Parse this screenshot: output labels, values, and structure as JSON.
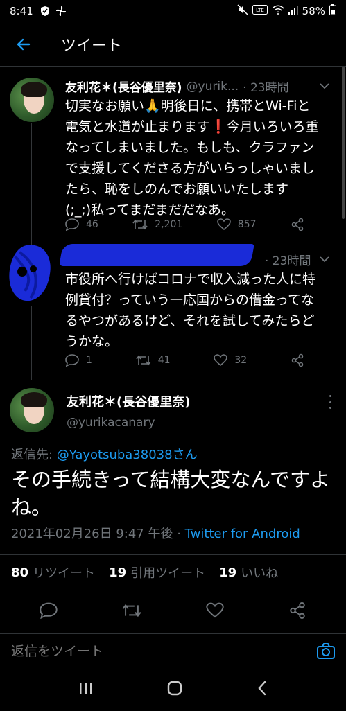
{
  "status_bar": {
    "time": "8:41",
    "battery": "58%"
  },
  "header": {
    "title": "ツイート"
  },
  "tweet1": {
    "name": "友利花＊(長谷優里奈)",
    "handle": "@yurik...",
    "time": "· 23時間",
    "lines": [
      "切実なお願い🙏明後日に、携帯とWi-Fiと",
      "電気と水道が止まります❗今月いろいろ重",
      "なってしまいました。もしも、クラファン",
      "で支援してくださる方がいらっしゃいまし",
      "たら、恥をしのんでお願いいたします",
      "(;_;)私ってまだまだだなあ。"
    ],
    "replies": "46",
    "retweets": "2,201",
    "likes": "857"
  },
  "tweet2": {
    "time": "· 23時間",
    "lines": [
      "市役所へ行けばコロナで収入減った人に特",
      "例貸付？っていう一応国からの借金ってな",
      "るやつがあるけど、それを試してみたらど",
      "うかな。"
    ],
    "replies": "1",
    "retweets": "41",
    "likes": "32"
  },
  "main": {
    "name": "友利花＊(長谷優里奈)",
    "handle": "@yurikacanary",
    "reply_prefix": "返信先: ",
    "reply_mention": "@Yayotsuba38038さん",
    "text_line1": "その手続きって結構大変なんですよ",
    "text_line2": "ね。",
    "timestamp": "2021年02月26日 9:47 午後 · ",
    "client": "Twitter for Android",
    "retweet_count": "80",
    "retweet_label": "リツイート",
    "quote_count": "19",
    "quote_label": "引用ツイート",
    "like_count": "19",
    "like_label": "いいね"
  },
  "reply_box": {
    "placeholder": "返信をツイート"
  },
  "colors": {
    "accent": "#1d9bf0",
    "muted": "#71767b",
    "scribble": "#1a2bd8"
  }
}
